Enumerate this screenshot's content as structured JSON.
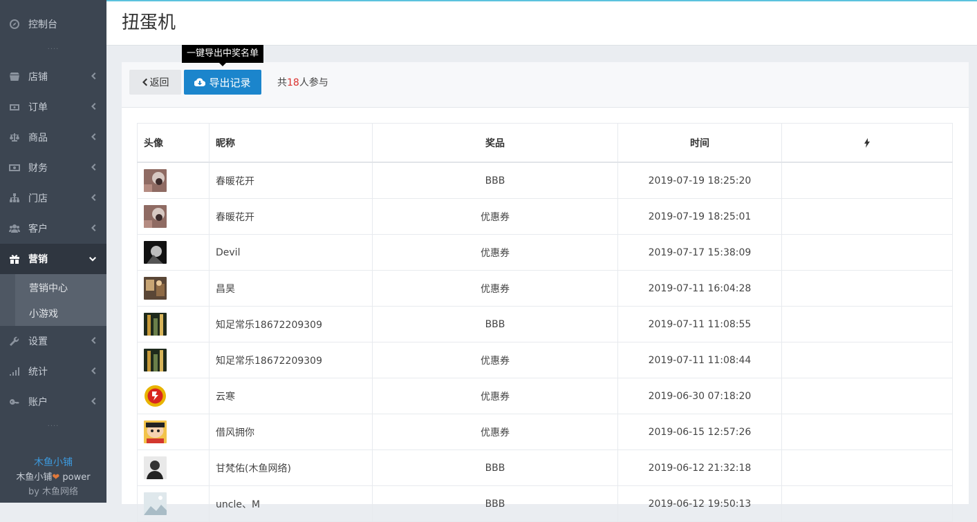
{
  "sidebar": {
    "top_item": {
      "label": "控制台",
      "icon": "dashboard-icon"
    },
    "items": [
      {
        "label": "店铺",
        "icon": "store-icon"
      },
      {
        "label": "订单",
        "icon": "order-icon"
      },
      {
        "label": "商品",
        "icon": "scale-icon"
      },
      {
        "label": "财务",
        "icon": "money-icon"
      },
      {
        "label": "门店",
        "icon": "sitemap-icon"
      },
      {
        "label": "客户",
        "icon": "users-icon"
      },
      {
        "label": "营销",
        "icon": "gift-icon"
      },
      {
        "label": "设置",
        "icon": "wrench-icon"
      },
      {
        "label": "统计",
        "icon": "signal-icon"
      },
      {
        "label": "账户",
        "icon": "key-icon"
      }
    ],
    "submenu": [
      {
        "label": "营销中心"
      },
      {
        "label": "小游戏"
      }
    ],
    "dots": "····",
    "footer": {
      "brand": "木鱼小铺",
      "line2_prefix": "木鱼小铺",
      "heart": "❤",
      "line2_suffix": " power",
      "line3": "by 木鱼网络"
    }
  },
  "header": {
    "title": "扭蛋机"
  },
  "toolbar": {
    "back_label": "返回",
    "export_label": "导出记录",
    "tooltip": "一键导出中奖名单",
    "count_prefix": "共",
    "count_value": "18",
    "count_suffix": "人参与"
  },
  "table": {
    "headers": {
      "avatar": "头像",
      "nickname": "昵称",
      "prize": "奖品",
      "time": "时间",
      "op_icon": "bolt-icon"
    },
    "rows": [
      {
        "nickname": "春暖花开",
        "prize": "BBB",
        "time": "2019-07-19 18:25:20"
      },
      {
        "nickname": "春暖花开",
        "prize": "优惠券",
        "time": "2019-07-19 18:25:01"
      },
      {
        "nickname": "Devil",
        "prize": "优惠券",
        "time": "2019-07-17 15:38:09"
      },
      {
        "nickname": "昌昊",
        "prize": "优惠券",
        "time": "2019-07-11 16:04:28"
      },
      {
        "nickname": "知足常乐18672209309",
        "prize": "BBB",
        "time": "2019-07-11 11:08:55"
      },
      {
        "nickname": "知足常乐18672209309",
        "prize": "优惠券",
        "time": "2019-07-11 11:08:44"
      },
      {
        "nickname": "云寒",
        "prize": "优惠券",
        "time": "2019-06-30 07:18:20"
      },
      {
        "nickname": "借风拥你",
        "prize": "优惠券",
        "time": "2019-06-15 12:57:26"
      },
      {
        "nickname": "甘梵佑(木鱼网络)",
        "prize": "BBB",
        "time": "2019-06-12 21:32:18"
      },
      {
        "nickname": "uncle、M",
        "prize": "BBB",
        "time": "2019-06-12 19:50:13"
      }
    ]
  },
  "colors": {
    "accent": "#1b85cc",
    "sidebar_bg": "#3c4551",
    "count_highlight": "#d9302c"
  }
}
